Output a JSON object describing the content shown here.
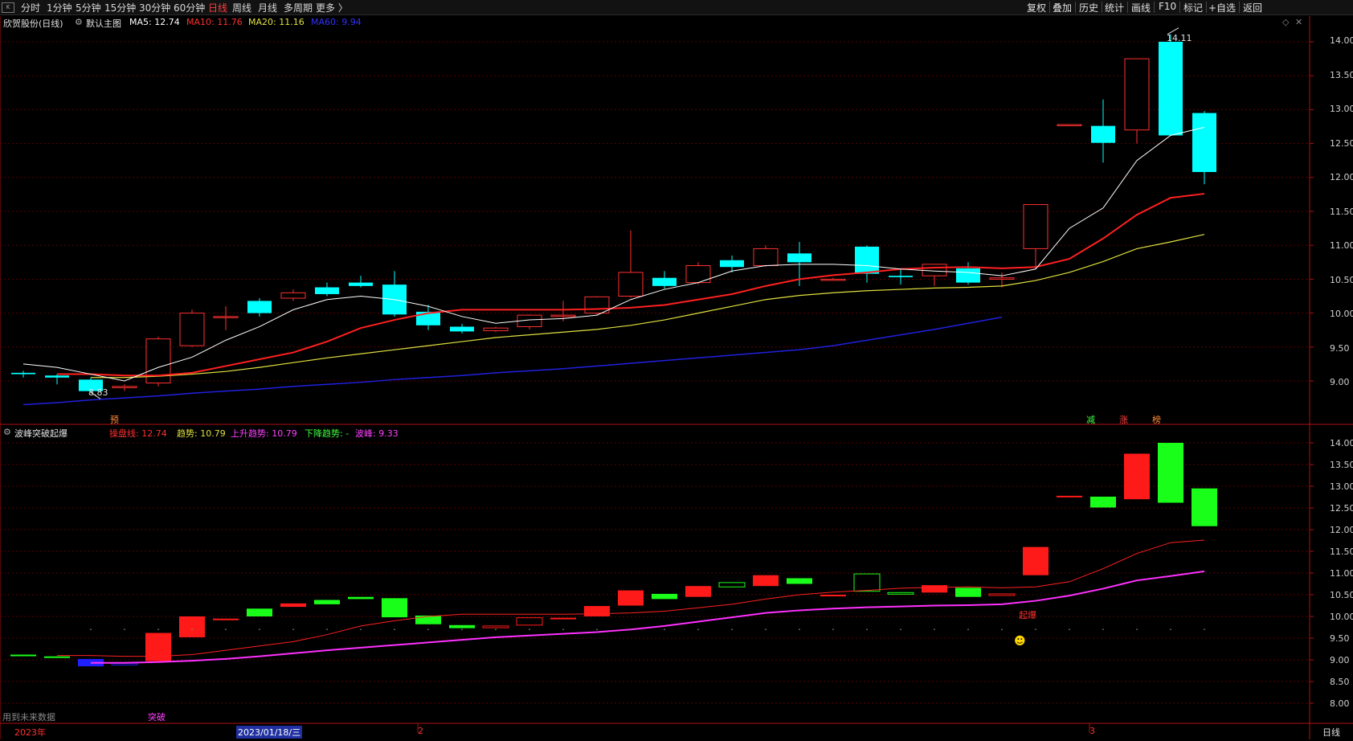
{
  "toolbar": {
    "periods": [
      "分时",
      "1分钟",
      "5分钟",
      "15分钟",
      "30分钟",
      "60分钟",
      "日线",
      "周线",
      "月线",
      "多周期",
      "更多 〉"
    ],
    "active_period": "日线",
    "tools": [
      "复权",
      "叠加",
      "历史",
      "统计",
      "画线",
      "F10",
      "标记",
      "+自选",
      "返回"
    ]
  },
  "main_panel": {
    "stock_title": "欣贺股份(日线)",
    "template": "默认主图",
    "ma5": "MA5: 12.74",
    "ma10": "MA10: 11.76",
    "ma20": "MA20: 11.16",
    "ma60": "MA60: 9.94",
    "high_label": "14.11",
    "low_label": "8.83",
    "markers": {
      "yu": "预",
      "jian": "减",
      "zhang": "涨",
      "bang": "榜"
    },
    "yaxis": [
      "14.00",
      "13.50",
      "13.00",
      "12.50",
      "12.00",
      "11.50",
      "11.00",
      "10.50",
      "10.00",
      "9.50",
      "9.00"
    ]
  },
  "sub_panel": {
    "title": "波峰突破起爆",
    "pan": "操盘线: 12.74",
    "trend": "趋势: 10.79",
    "up": "上升趋势: 10.79",
    "down": "下降趋势: -",
    "wave": "波峰: 9.33",
    "qibao": "起爆",
    "tupo": "突破",
    "future": "用到未来数据",
    "yaxis": [
      "14.00",
      "13.50",
      "13.00",
      "12.50",
      "12.00",
      "11.50",
      "11.00",
      "10.50",
      "10.00",
      "9.50",
      "9.00",
      "8.50",
      "8.00"
    ]
  },
  "xaxis": {
    "year": "2023年",
    "date": "2023/01/18/三",
    "m2": "2",
    "m3": "3",
    "period": "日线"
  },
  "colors": {
    "up": "#ff3030",
    "down": "#00ffff",
    "ma5": "#ffffff",
    "ma10": "#ff2020",
    "ma20": "#e0e040",
    "ma60": "#2020e0"
  },
  "chart_data": {
    "type": "candlestick",
    "candles": [
      [
        9.12,
        9.15,
        9.05,
        9.1
      ],
      [
        9.08,
        9.1,
        8.95,
        9.05
      ],
      [
        9.02,
        9.05,
        8.83,
        8.85
      ],
      [
        8.9,
        8.95,
        8.85,
        8.92
      ],
      [
        8.97,
        9.65,
        8.92,
        9.62
      ],
      [
        9.52,
        10.05,
        9.5,
        10.0
      ],
      [
        9.95,
        10.1,
        9.75,
        9.95
      ],
      [
        10.18,
        10.22,
        9.95,
        10.0
      ],
      [
        10.22,
        10.35,
        10.18,
        10.3
      ],
      [
        10.38,
        10.45,
        10.25,
        10.28
      ],
      [
        10.45,
        10.55,
        10.38,
        10.4
      ],
      [
        10.42,
        10.62,
        9.95,
        9.98
      ],
      [
        10.02,
        10.12,
        9.75,
        9.82
      ],
      [
        9.8,
        9.84,
        9.7,
        9.73
      ],
      [
        9.74,
        9.8,
        9.72,
        9.78
      ],
      [
        9.8,
        9.98,
        9.76,
        9.97
      ],
      [
        9.95,
        10.18,
        9.88,
        9.97
      ],
      [
        10.0,
        10.25,
        9.98,
        10.24
      ],
      [
        10.25,
        11.22,
        10.23,
        10.6
      ],
      [
        10.52,
        10.62,
        10.36,
        10.4
      ],
      [
        10.45,
        10.75,
        10.42,
        10.7
      ],
      [
        10.78,
        10.85,
        10.6,
        10.68
      ],
      [
        10.7,
        11.0,
        10.68,
        10.95
      ],
      [
        10.88,
        11.05,
        10.4,
        10.75
      ],
      [
        10.5,
        10.52,
        10.48,
        10.5
      ],
      [
        10.98,
        11.0,
        10.45,
        10.58
      ],
      [
        10.55,
        10.65,
        10.42,
        10.53
      ],
      [
        10.55,
        10.7,
        10.4,
        10.72
      ],
      [
        10.66,
        10.75,
        10.42,
        10.45
      ],
      [
        10.5,
        10.6,
        10.38,
        10.52
      ],
      [
        10.95,
        11.6,
        10.65,
        11.6
      ],
      [
        12.78,
        12.78,
        12.78,
        12.78
      ],
      [
        12.76,
        13.15,
        12.22,
        12.51
      ],
      [
        12.7,
        13.75,
        12.5,
        13.75
      ],
      [
        14.0,
        14.11,
        12.62,
        12.62
      ],
      [
        12.95,
        12.98,
        11.9,
        12.08
      ]
    ],
    "ma5": [
      9.25,
      9.2,
      9.1,
      9.0,
      9.2,
      9.35,
      9.6,
      9.8,
      10.05,
      10.2,
      10.25,
      10.2,
      10.1,
      9.95,
      9.85,
      9.9,
      9.92,
      9.97,
      10.2,
      10.35,
      10.45,
      10.62,
      10.7,
      10.72,
      10.72,
      10.7,
      10.65,
      10.62,
      10.6,
      10.55,
      10.65,
      11.25,
      11.55,
      12.25,
      12.62,
      12.74
    ],
    "ma10": [
      9.1,
      9.1,
      9.08,
      9.08,
      9.12,
      9.22,
      9.32,
      9.42,
      9.58,
      9.78,
      9.9,
      10.0,
      10.05,
      10.05,
      10.05,
      10.05,
      10.06,
      10.08,
      10.12,
      10.2,
      10.28,
      10.4,
      10.5,
      10.56,
      10.6,
      10.65,
      10.67,
      10.68,
      10.66,
      10.68,
      10.8,
      11.1,
      11.45,
      11.7,
      11.76
    ],
    "ma20": [
      9.05,
      9.05,
      9.07,
      9.1,
      9.14,
      9.2,
      9.27,
      9.34,
      9.4,
      9.46,
      9.52,
      9.58,
      9.64,
      9.68,
      9.72,
      9.76,
      9.82,
      9.9,
      10.0,
      10.1,
      10.2,
      10.26,
      10.3,
      10.33,
      10.35,
      10.37,
      10.38,
      10.4,
      10.48,
      10.6,
      10.76,
      10.95,
      11.05,
      11.16
    ],
    "ma60": [
      8.65,
      8.68,
      8.72,
      8.75,
      8.78,
      8.82,
      8.85,
      8.88,
      8.92,
      8.95,
      8.98,
      9.02,
      9.05,
      9.08,
      9.12,
      9.15,
      9.18,
      9.22,
      9.26,
      9.3,
      9.34,
      9.38,
      9.42,
      9.46,
      9.52,
      9.6,
      9.68,
      9.76,
      9.85,
      9.94
    ]
  }
}
